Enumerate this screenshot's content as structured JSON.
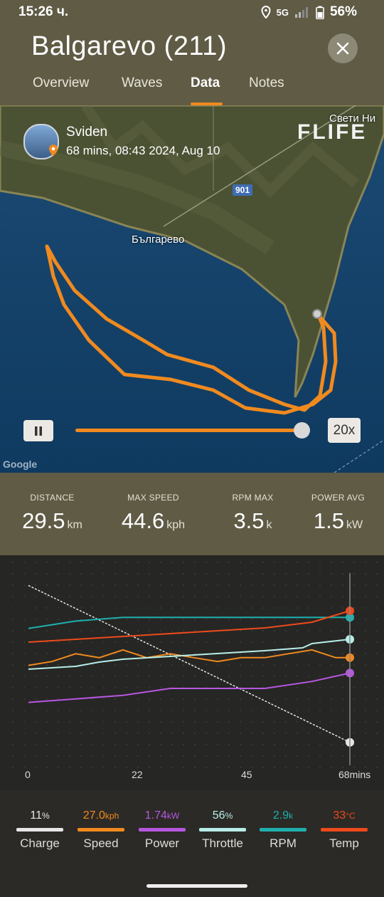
{
  "status": {
    "time": "15:26 ч.",
    "network": "5G",
    "battery": "56%"
  },
  "header": {
    "title": "Balgarevo (211)"
  },
  "tabs": [
    "Overview",
    "Waves",
    "Data",
    "Notes"
  ],
  "active_tab": "Data",
  "map": {
    "user_name": "Sviden",
    "ride_meta": "68 mins, 08:43 2024, Aug 10",
    "logo": "FLIFE",
    "place_1": "Българево",
    "place_2": "Свети Ни",
    "road_number": "901",
    "attribution": "Google",
    "playback_speed": "20x",
    "playback_progress": 1.0
  },
  "stats": [
    {
      "label": "DISTANCE",
      "value": "29.5",
      "unit": "km"
    },
    {
      "label": "MAX SPEED",
      "value": "44.6",
      "unit": "kph"
    },
    {
      "label": "RPM MAX",
      "value": "3.5",
      "unit": "k"
    },
    {
      "label": "POWER AVG",
      "value": "1.5",
      "unit": "kW"
    }
  ],
  "chart_data": {
    "type": "line",
    "x_ticks": [
      "0",
      "22",
      "45",
      "68mins"
    ],
    "xlim": [
      0,
      68
    ],
    "series": [
      {
        "name": "Charge",
        "color": "#e6e6e6",
        "x": [
          0,
          68
        ],
        "y": [
          100,
          11
        ]
      },
      {
        "name": "Speed",
        "color": "#f08a1f",
        "x": [
          0,
          5,
          10,
          15,
          20,
          25,
          30,
          35,
          40,
          45,
          50,
          55,
          60,
          65,
          68
        ],
        "y": [
          25,
          26,
          28,
          27,
          29,
          27,
          28,
          27,
          26,
          27,
          27,
          28,
          29,
          27,
          27
        ]
      },
      {
        "name": "Power",
        "color": "#b757e0",
        "x": [
          0,
          10,
          20,
          30,
          40,
          50,
          60,
          68
        ],
        "y": [
          0.9,
          1.0,
          1.1,
          1.3,
          1.3,
          1.3,
          1.5,
          1.74
        ]
      },
      {
        "name": "Throttle",
        "color": "#b8ede8",
        "x": [
          0,
          10,
          15,
          20,
          30,
          40,
          50,
          58,
          60,
          68
        ],
        "y": [
          35,
          37,
          40,
          42,
          44,
          46,
          48,
          50,
          53,
          56
        ]
      },
      {
        "name": "RPM",
        "color": "#1fb0ae",
        "x": [
          0,
          10,
          20,
          30,
          40,
          50,
          60,
          68
        ],
        "y": [
          2.6,
          2.8,
          2.9,
          2.9,
          2.9,
          2.9,
          2.9,
          2.9
        ]
      },
      {
        "name": "Temp",
        "color": "#ee4a1c",
        "x": [
          0,
          10,
          20,
          30,
          40,
          50,
          60,
          68
        ],
        "y": [
          22,
          23,
          24,
          25,
          26,
          27,
          29,
          33
        ]
      }
    ]
  },
  "legend": [
    {
      "value": "11",
      "unit": "%",
      "name": "Charge",
      "color": "#e6e6e6"
    },
    {
      "value": "27.0",
      "unit": "kph",
      "name": "Speed",
      "color": "#f08a1f"
    },
    {
      "value": "1.74",
      "unit": "kW",
      "name": "Power",
      "color": "#b757e0"
    },
    {
      "value": "56",
      "unit": "%",
      "name": "Throttle",
      "color": "#b8ede8"
    },
    {
      "value": "2.9",
      "unit": "k",
      "name": "RPM",
      "color": "#1fb0ae"
    },
    {
      "value": "33",
      "unit": "°C",
      "name": "Temp",
      "color": "#ee4a1c"
    }
  ]
}
